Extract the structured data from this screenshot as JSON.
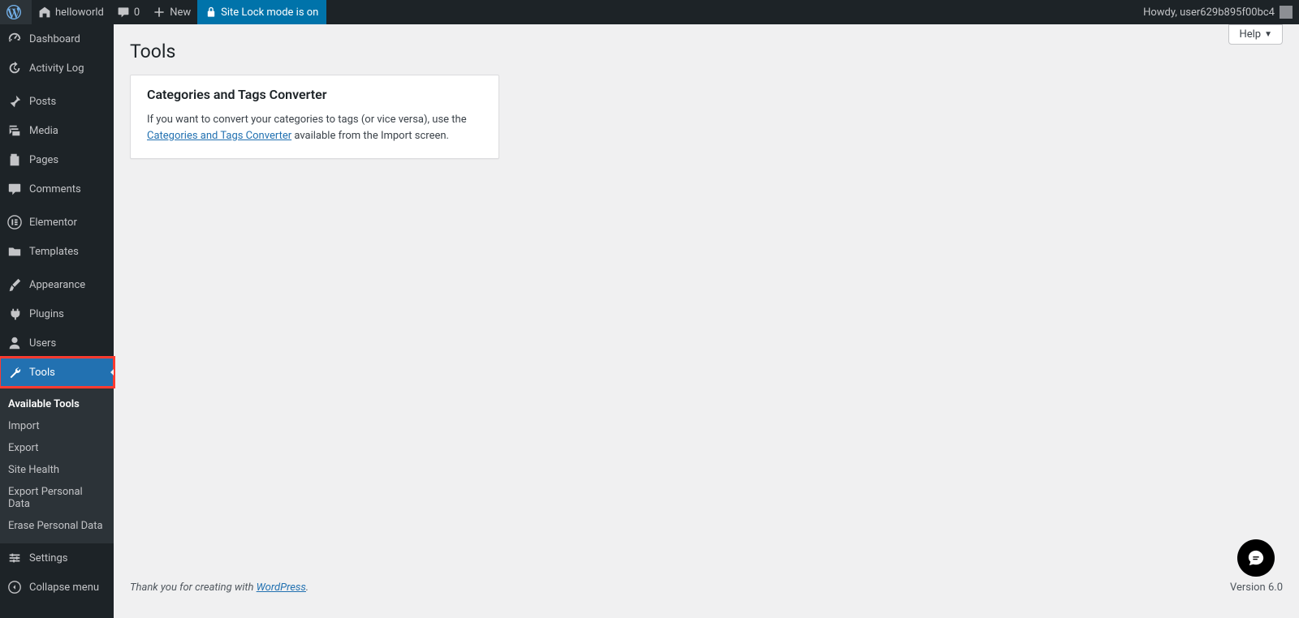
{
  "topbar": {
    "site_name": "helloworld",
    "comment_count": "0",
    "new_label": "New",
    "lock_label": "Site Lock mode is on",
    "howdy": "Howdy, user629b895f00bc4"
  },
  "sidebar": {
    "items": [
      {
        "label": "Dashboard",
        "icon": "dashboard-icon"
      },
      {
        "label": "Activity Log",
        "icon": "history-icon"
      },
      {
        "label": "Posts",
        "icon": "pin-icon"
      },
      {
        "label": "Media",
        "icon": "media-icon"
      },
      {
        "label": "Pages",
        "icon": "page-icon"
      },
      {
        "label": "Comments",
        "icon": "comment-icon"
      },
      {
        "label": "Elementor",
        "icon": "elementor-icon"
      },
      {
        "label": "Templates",
        "icon": "folder-icon"
      },
      {
        "label": "Appearance",
        "icon": "brush-icon"
      },
      {
        "label": "Plugins",
        "icon": "plug-icon"
      },
      {
        "label": "Users",
        "icon": "user-icon"
      },
      {
        "label": "Tools",
        "icon": "wrench-icon"
      },
      {
        "label": "Settings",
        "icon": "settings-icon"
      },
      {
        "label": "Collapse menu",
        "icon": "collapse-icon"
      }
    ],
    "submenu": [
      {
        "label": "Available Tools",
        "current": true
      },
      {
        "label": "Import"
      },
      {
        "label": "Export"
      },
      {
        "label": "Site Health"
      },
      {
        "label": "Export Personal Data"
      },
      {
        "label": "Erase Personal Data"
      }
    ]
  },
  "page": {
    "title": "Tools",
    "help_label": "Help"
  },
  "card": {
    "heading": "Categories and Tags Converter",
    "text_before": "If you want to convert your categories to tags (or vice versa), use the ",
    "link_text": "Categories and Tags Converter",
    "text_after": " available from the Import screen."
  },
  "footer": {
    "thanks_before": "Thank you for creating with ",
    "link_text": "WordPress",
    "thanks_after": ".",
    "version": "Version 6.0"
  }
}
